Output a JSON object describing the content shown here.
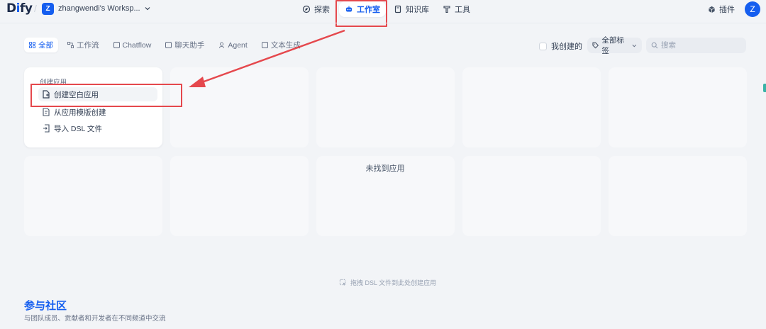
{
  "app": {
    "logo_text_1": "D",
    "logo_text_2": "i",
    "logo_text_3": "fy",
    "workspace_initial": "Z",
    "workspace_name": "zhangwendi's Worksp...",
    "user_initial": "Z"
  },
  "nav": {
    "explore": "探索",
    "studio": "工作室",
    "knowledge": "知识库",
    "tools": "工具",
    "plugins": "插件"
  },
  "filters": {
    "all": "全部",
    "workflow": "工作流",
    "chatflow": "Chatflow",
    "chatbot": "聊天助手",
    "agent": "Agent",
    "completion": "文本生成"
  },
  "toolbar": {
    "mine_label": "我创建的",
    "tags_label": "全部标签",
    "search_placeholder": "搜索"
  },
  "create_card": {
    "title": "创建应用",
    "blank": "创建空白应用",
    "template": "从应用模版创建",
    "import_dsl": "导入 DSL 文件"
  },
  "empty_state": "未找到应用",
  "drop_hint": "拖拽 DSL 文件到此处创建应用",
  "community": {
    "title": "参与社区",
    "desc": "与团队成员、贡献者和开发者在不同频道中交流"
  },
  "colors": {
    "accent": "#155eef",
    "annotation_red": "#e5484d"
  }
}
